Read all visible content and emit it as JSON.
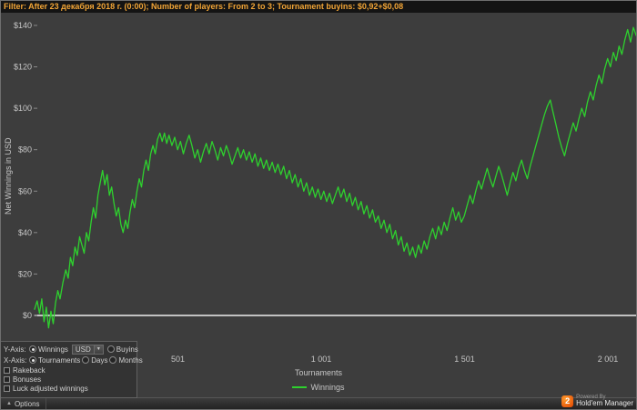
{
  "filter_bar": {
    "text": "Filter: After 23 декабря 2018 г. (0:00); Number of players: From 2 to 3; Tournament buyins: $0,92+$0,08"
  },
  "chart_data": {
    "type": "line",
    "title": "",
    "xlabel": "Tournaments",
    "ylabel": "Net Winnings in USD",
    "xlim": [
      1,
      2100
    ],
    "ylim": [
      -19,
      146
    ],
    "grid": false,
    "legend_position": "bottom",
    "zero_line": 0,
    "zero_line_color": "#eeeeee",
    "y_ticks": [
      {
        "value": 0,
        "label": "$0"
      },
      {
        "value": 20,
        "label": "$20"
      },
      {
        "value": 40,
        "label": "$40"
      },
      {
        "value": 60,
        "label": "$60"
      },
      {
        "value": 80,
        "label": "$80"
      },
      {
        "value": 100,
        "label": "$100"
      },
      {
        "value": 120,
        "label": "$120"
      },
      {
        "value": 140,
        "label": "$140"
      }
    ],
    "x_ticks": [
      {
        "value": 501,
        "label": "501"
      },
      {
        "value": 1001,
        "label": "1 001"
      },
      {
        "value": 1501,
        "label": "1 501"
      },
      {
        "value": 2001,
        "label": "2 001"
      }
    ],
    "series": [
      {
        "name": "Winnings",
        "color": "#2ed12e",
        "points": [
          [
            1,
            3
          ],
          [
            10,
            7
          ],
          [
            18,
            1
          ],
          [
            26,
            8
          ],
          [
            34,
            -3
          ],
          [
            42,
            4
          ],
          [
            50,
            -6
          ],
          [
            58,
            2
          ],
          [
            66,
            -4
          ],
          [
            74,
            6
          ],
          [
            82,
            12
          ],
          [
            90,
            8
          ],
          [
            100,
            16
          ],
          [
            110,
            22
          ],
          [
            118,
            18
          ],
          [
            126,
            28
          ],
          [
            134,
            24
          ],
          [
            142,
            33
          ],
          [
            150,
            29
          ],
          [
            158,
            38
          ],
          [
            166,
            34
          ],
          [
            174,
            30
          ],
          [
            182,
            40
          ],
          [
            190,
            36
          ],
          [
            198,
            45
          ],
          [
            206,
            52
          ],
          [
            214,
            47
          ],
          [
            222,
            58
          ],
          [
            230,
            64
          ],
          [
            238,
            70
          ],
          [
            246,
            63
          ],
          [
            254,
            68
          ],
          [
            262,
            58
          ],
          [
            270,
            62
          ],
          [
            278,
            54
          ],
          [
            286,
            48
          ],
          [
            294,
            52
          ],
          [
            302,
            44
          ],
          [
            310,
            40
          ],
          [
            318,
            46
          ],
          [
            326,
            42
          ],
          [
            334,
            50
          ],
          [
            342,
            56
          ],
          [
            350,
            52
          ],
          [
            358,
            60
          ],
          [
            366,
            66
          ],
          [
            374,
            62
          ],
          [
            382,
            70
          ],
          [
            390,
            75
          ],
          [
            398,
            70
          ],
          [
            406,
            78
          ],
          [
            414,
            82
          ],
          [
            422,
            78
          ],
          [
            430,
            85
          ],
          [
            438,
            88
          ],
          [
            446,
            84
          ],
          [
            454,
            88
          ],
          [
            462,
            83
          ],
          [
            470,
            87
          ],
          [
            480,
            82
          ],
          [
            490,
            86
          ],
          [
            500,
            80
          ],
          [
            510,
            84
          ],
          [
            520,
            78
          ],
          [
            530,
            83
          ],
          [
            540,
            87
          ],
          [
            550,
            82
          ],
          [
            560,
            76
          ],
          [
            570,
            80
          ],
          [
            580,
            74
          ],
          [
            590,
            79
          ],
          [
            600,
            83
          ],
          [
            610,
            78
          ],
          [
            620,
            84
          ],
          [
            630,
            80
          ],
          [
            640,
            75
          ],
          [
            650,
            81
          ],
          [
            660,
            77
          ],
          [
            670,
            82
          ],
          [
            680,
            78
          ],
          [
            690,
            73
          ],
          [
            700,
            77
          ],
          [
            710,
            81
          ],
          [
            720,
            76
          ],
          [
            730,
            80
          ],
          [
            740,
            75
          ],
          [
            750,
            79
          ],
          [
            760,
            74
          ],
          [
            770,
            78
          ],
          [
            780,
            72
          ],
          [
            790,
            76
          ],
          [
            800,
            71
          ],
          [
            810,
            75
          ],
          [
            820,
            70
          ],
          [
            830,
            74
          ],
          [
            840,
            69
          ],
          [
            850,
            73
          ],
          [
            860,
            68
          ],
          [
            870,
            72
          ],
          [
            880,
            66
          ],
          [
            890,
            70
          ],
          [
            900,
            64
          ],
          [
            910,
            68
          ],
          [
            920,
            62
          ],
          [
            930,
            66
          ],
          [
            940,
            60
          ],
          [
            950,
            64
          ],
          [
            960,
            58
          ],
          [
            970,
            62
          ],
          [
            980,
            57
          ],
          [
            990,
            61
          ],
          [
            1000,
            56
          ],
          [
            1010,
            60
          ],
          [
            1020,
            55
          ],
          [
            1030,
            59
          ],
          [
            1040,
            54
          ],
          [
            1050,
            58
          ],
          [
            1060,
            62
          ],
          [
            1070,
            57
          ],
          [
            1080,
            61
          ],
          [
            1090,
            55
          ],
          [
            1100,
            59
          ],
          [
            1110,
            53
          ],
          [
            1120,
            57
          ],
          [
            1130,
            51
          ],
          [
            1140,
            55
          ],
          [
            1150,
            49
          ],
          [
            1160,
            53
          ],
          [
            1170,
            47
          ],
          [
            1180,
            51
          ],
          [
            1190,
            45
          ],
          [
            1200,
            48
          ],
          [
            1210,
            42
          ],
          [
            1220,
            46
          ],
          [
            1230,
            40
          ],
          [
            1240,
            44
          ],
          [
            1250,
            37
          ],
          [
            1260,
            41
          ],
          [
            1270,
            34
          ],
          [
            1280,
            38
          ],
          [
            1290,
            31
          ],
          [
            1300,
            35
          ],
          [
            1310,
            29
          ],
          [
            1320,
            33
          ],
          [
            1330,
            28
          ],
          [
            1340,
            34
          ],
          [
            1350,
            30
          ],
          [
            1360,
            36
          ],
          [
            1370,
            32
          ],
          [
            1380,
            38
          ],
          [
            1390,
            42
          ],
          [
            1400,
            37
          ],
          [
            1410,
            43
          ],
          [
            1420,
            39
          ],
          [
            1430,
            45
          ],
          [
            1440,
            41
          ],
          [
            1450,
            47
          ],
          [
            1460,
            52
          ],
          [
            1470,
            46
          ],
          [
            1480,
            50
          ],
          [
            1490,
            45
          ],
          [
            1500,
            48
          ],
          [
            1510,
            53
          ],
          [
            1520,
            58
          ],
          [
            1530,
            54
          ],
          [
            1540,
            60
          ],
          [
            1550,
            65
          ],
          [
            1560,
            61
          ],
          [
            1570,
            66
          ],
          [
            1580,
            71
          ],
          [
            1590,
            66
          ],
          [
            1600,
            62
          ],
          [
            1610,
            67
          ],
          [
            1620,
            72
          ],
          [
            1630,
            68
          ],
          [
            1640,
            63
          ],
          [
            1650,
            58
          ],
          [
            1660,
            64
          ],
          [
            1670,
            69
          ],
          [
            1680,
            65
          ],
          [
            1690,
            71
          ],
          [
            1700,
            75
          ],
          [
            1710,
            70
          ],
          [
            1720,
            66
          ],
          [
            1730,
            72
          ],
          [
            1740,
            77
          ],
          [
            1750,
            82
          ],
          [
            1760,
            87
          ],
          [
            1770,
            92
          ],
          [
            1780,
            97
          ],
          [
            1790,
            101
          ],
          [
            1800,
            104
          ],
          [
            1810,
            98
          ],
          [
            1820,
            92
          ],
          [
            1830,
            86
          ],
          [
            1840,
            81
          ],
          [
            1850,
            77
          ],
          [
            1860,
            83
          ],
          [
            1870,
            88
          ],
          [
            1880,
            93
          ],
          [
            1890,
            89
          ],
          [
            1900,
            95
          ],
          [
            1910,
            100
          ],
          [
            1920,
            96
          ],
          [
            1930,
            103
          ],
          [
            1940,
            108
          ],
          [
            1950,
            104
          ],
          [
            1960,
            111
          ],
          [
            1970,
            116
          ],
          [
            1980,
            112
          ],
          [
            1990,
            119
          ],
          [
            2000,
            124
          ],
          [
            2010,
            120
          ],
          [
            2020,
            127
          ],
          [
            2030,
            123
          ],
          [
            2040,
            130
          ],
          [
            2050,
            126
          ],
          [
            2060,
            133
          ],
          [
            2070,
            138
          ],
          [
            2080,
            132
          ],
          [
            2090,
            139
          ],
          [
            2100,
            135
          ]
        ]
      }
    ]
  },
  "controls": {
    "y_axis_row": {
      "label": "Y-Axis:",
      "winnings": {
        "label": "Winnings",
        "selected": true
      },
      "currency": {
        "value": "USD"
      },
      "buyins": {
        "label": "Buyins",
        "selected": false
      }
    },
    "x_axis_row": {
      "label": "X-Axis:",
      "tournaments": {
        "label": "Tournaments",
        "selected": true
      },
      "days": {
        "label": "Days",
        "selected": false
      },
      "months": {
        "label": "Months",
        "selected": false
      }
    },
    "checkboxes": [
      {
        "label": "Rakeback",
        "checked": false
      },
      {
        "label": "Bonuses",
        "checked": false
      },
      {
        "label": "Luck adjusted winnings",
        "checked": false
      }
    ]
  },
  "footer": {
    "options_label": "Options"
  },
  "branding": {
    "powered_by": "Powered By",
    "app_name": "Hold'em Manager",
    "logo_number": "2"
  }
}
